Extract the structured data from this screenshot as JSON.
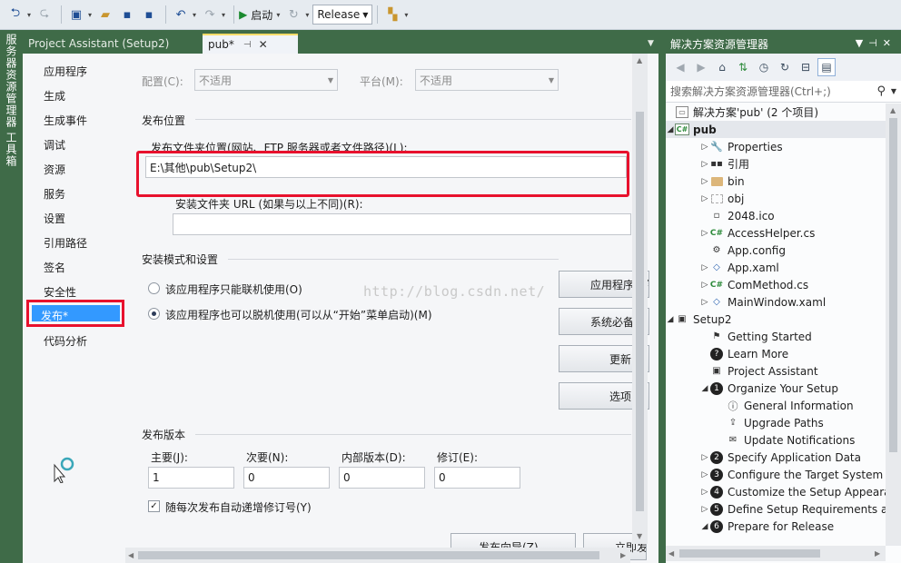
{
  "toolbar": {
    "start_label": "启动",
    "config_value": "Release"
  },
  "left_strip": {
    "tab1": "服务器资源管理器",
    "tab2": "工具箱"
  },
  "doc_tabs": {
    "tab1": "Project Assistant (Setup2)",
    "tab2": "pub*"
  },
  "nav": {
    "items": [
      "应用程序",
      "生成",
      "生成事件",
      "调试",
      "资源",
      "服务",
      "设置",
      "引用路径",
      "签名",
      "安全性",
      "发布*",
      "代码分析"
    ],
    "selected_index": 10
  },
  "publish": {
    "config_label": "配置(C):",
    "config_value": "不适用",
    "platform_label": "平台(M):",
    "platform_value": "不适用",
    "location_section": "发布位置",
    "folder_label": "发布文件夹位置(网站、FTP 服务器或者文件路径)(L):",
    "folder_value": "E:\\其他\\pub\\Setup2\\",
    "install_url_label": "安装文件夹 URL (如果与以上不同)(R):",
    "install_url_value": "",
    "mode_section": "安装模式和设置",
    "radio_online": "该应用程序只能联机使用(O)",
    "radio_offline": "该应用程序也可以脱机使用(可以从“开始”菜单启动)(M)",
    "btn_app": "应用程序文件",
    "btn_prereq": "系统必备",
    "btn_update": "更新",
    "btn_options": "选项",
    "version_section": "发布版本",
    "major_label": "主要(J):",
    "major_value": "1",
    "minor_label": "次要(N):",
    "minor_value": "0",
    "build_label": "内部版本(D):",
    "build_value": "0",
    "revision_label": "修订(E):",
    "revision_value": "0",
    "auto_increment_label": "随每次发布自动递增修订号(Y)",
    "auto_increment_checked": true,
    "btn_wizard": "发布向导(Z)...",
    "btn_publish_now": "立即发布"
  },
  "watermark": "http://blog.csdn.net/",
  "solution_explorer": {
    "title": "解决方案资源管理器",
    "search_placeholder": "搜索解决方案资源管理器(Ctrl+;)",
    "tree": [
      {
        "text": "解决方案'pub' (2 个项目)",
        "indent": 0,
        "twisty": "",
        "icon": "solution-icon"
      },
      {
        "text": "pub",
        "indent": 0,
        "twisty": "expanded",
        "icon": "csharp-project-icon",
        "selected": true
      },
      {
        "text": "Properties",
        "indent": 1,
        "twisty": "collapsed",
        "icon": "wrench-icon"
      },
      {
        "text": "引用",
        "indent": 1,
        "twisty": "collapsed",
        "icon": "references-icon"
      },
      {
        "text": "bin",
        "indent": 1,
        "twisty": "collapsed",
        "icon": "folder-icon"
      },
      {
        "text": "obj",
        "indent": 1,
        "twisty": "collapsed",
        "icon": "hidden-folder-icon"
      },
      {
        "text": "2048.ico",
        "indent": 1,
        "twisty": "",
        "icon": "ico-file-icon"
      },
      {
        "text": "AccessHelper.cs",
        "indent": 1,
        "twisty": "collapsed",
        "icon": "csharp-file-icon"
      },
      {
        "text": "App.config",
        "indent": 1,
        "twisty": "",
        "icon": "config-file-icon"
      },
      {
        "text": "App.xaml",
        "indent": 1,
        "twisty": "collapsed",
        "icon": "xaml-file-icon"
      },
      {
        "text": "ComMethod.cs",
        "indent": 1,
        "twisty": "collapsed",
        "icon": "csharp-file-icon"
      },
      {
        "text": "MainWindow.xaml",
        "indent": 1,
        "twisty": "collapsed",
        "icon": "xaml-file-icon"
      },
      {
        "text": "Setup2",
        "indent": 0,
        "twisty": "expanded",
        "icon": "setup-project-icon"
      },
      {
        "text": "Getting Started",
        "indent": 1,
        "twisty": "",
        "icon": "getting-started-icon"
      },
      {
        "text": "Learn More",
        "indent": 1,
        "twisty": "",
        "icon": "help-icon"
      },
      {
        "text": "Project Assistant",
        "indent": 1,
        "twisty": "",
        "icon": "project-assistant-icon"
      },
      {
        "text": "Organize Your Setup",
        "indent": 1,
        "twisty": "expanded",
        "icon": "step-1-icon",
        "badge": "1"
      },
      {
        "text": "General Information",
        "indent": 2,
        "twisty": "",
        "icon": "info-icon"
      },
      {
        "text": "Upgrade Paths",
        "indent": 2,
        "twisty": "",
        "icon": "upgrade-icon"
      },
      {
        "text": "Update Notifications",
        "indent": 2,
        "twisty": "",
        "icon": "notification-icon"
      },
      {
        "text": "Specify Application Data",
        "indent": 1,
        "twisty": "collapsed",
        "icon": "step-2-icon",
        "badge": "2"
      },
      {
        "text": "Configure the Target System",
        "indent": 1,
        "twisty": "collapsed",
        "icon": "step-3-icon",
        "badge": "3"
      },
      {
        "text": "Customize the Setup Appeara",
        "indent": 1,
        "twisty": "collapsed",
        "icon": "step-4-icon",
        "badge": "4"
      },
      {
        "text": "Define Setup Requirements a",
        "indent": 1,
        "twisty": "collapsed",
        "icon": "step-5-icon",
        "badge": "5"
      },
      {
        "text": "Prepare for Release",
        "indent": 1,
        "twisty": "expanded",
        "icon": "step-6-icon",
        "badge": "6"
      }
    ]
  }
}
